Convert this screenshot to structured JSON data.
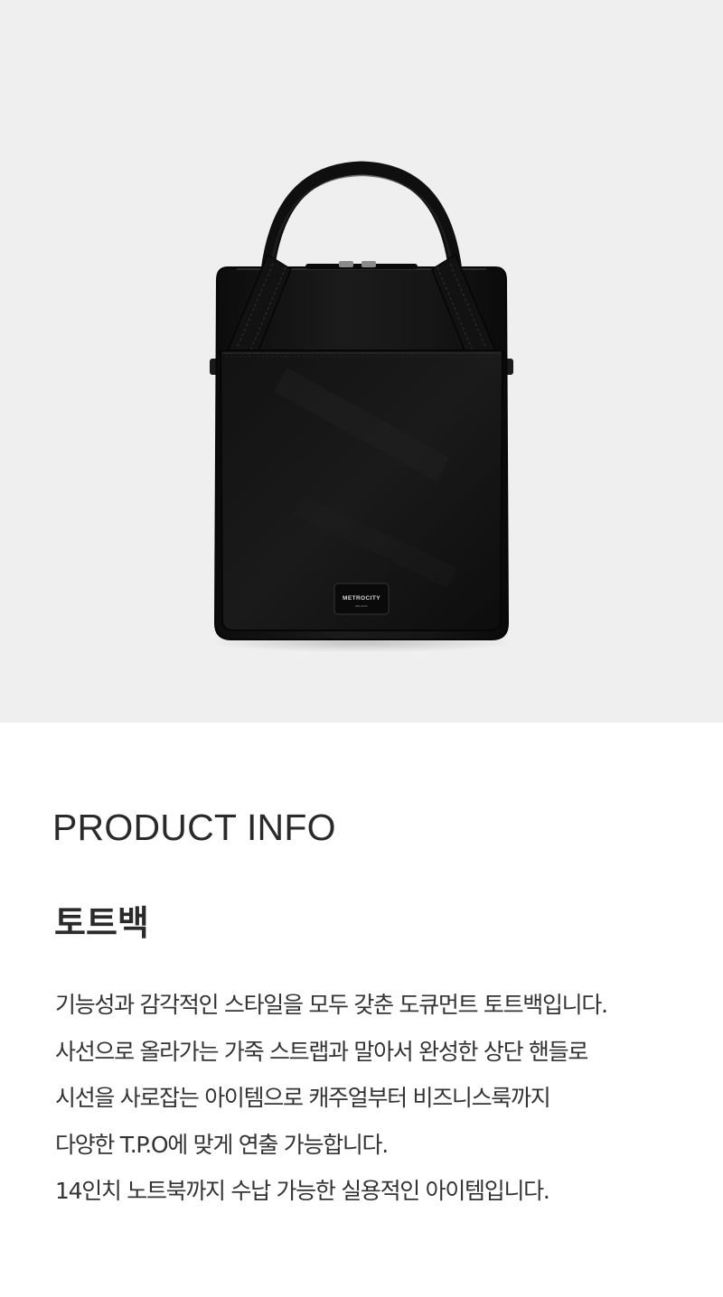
{
  "hero": {
    "image_alt": "Black leather document tote bag",
    "brand_label": "METROCITY",
    "brand_sublabel": "MILANO",
    "background_color": "#efefef",
    "bag_color": "#141414"
  },
  "info": {
    "section_heading": "PRODUCT INFO",
    "product_name": "토트백",
    "description_lines": [
      "기능성과 감각적인 스타일을 모두 갖춘 도큐먼트 토트백입니다.",
      "사선으로 올라가는 가죽 스트랩과 말아서 완성한 상단 핸들로",
      "시선을 사로잡는 아이템으로 캐주얼부터 비즈니스룩까지",
      "다양한 T.P.O에 맞게 연출 가능합니다.",
      "14인치 노트북까지 수납 가능한 실용적인 아이템입니다."
    ]
  }
}
